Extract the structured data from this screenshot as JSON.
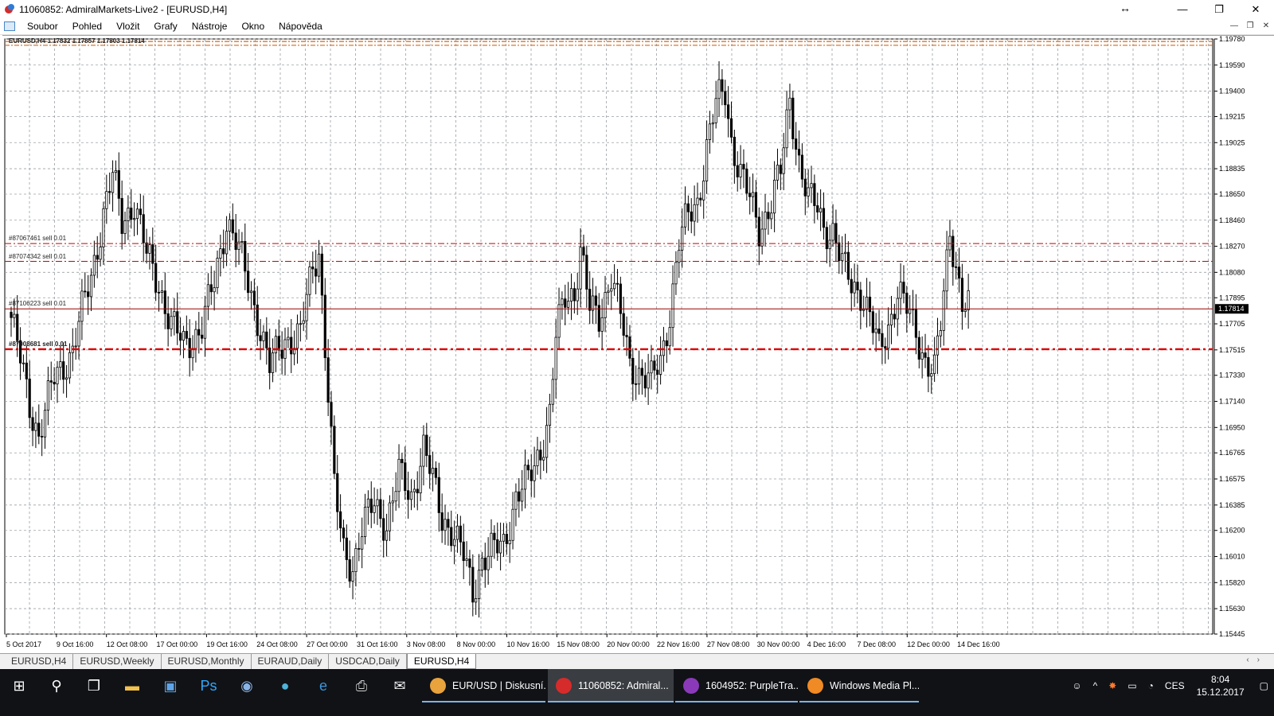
{
  "window": {
    "title": "11060852: AdmiralMarkets-Live2 - [EURUSD,H4]",
    "controls": [
      "↔",
      "—",
      "❐",
      "✕"
    ]
  },
  "menu": [
    "Soubor",
    "Pohled",
    "Vložit",
    "Grafy",
    "Nástroje",
    "Okno",
    "Nápověda"
  ],
  "chart": {
    "header": "EURUSD,H4  1.17832 1.17857 1.17803 1.17814",
    "current_price": "1.17814",
    "order_lines": [
      {
        "label": "#87067461 sell 0.01",
        "price": 1.1829,
        "color": "#cc0000",
        "style": "dashdot"
      },
      {
        "label": "#87074342 sell 0.01",
        "price": 1.1816,
        "color": "#cc0000",
        "style": "dashdot"
      },
      {
        "label": "#87106223 sell 0.01",
        "price": 1.17814,
        "color": "#990000",
        "style": "solid"
      },
      {
        "label": "#87008681 sell 0.01",
        "price": 1.1752,
        "color": "#dd0000",
        "style": "dashdot-bold"
      }
    ],
    "top_lines": [
      {
        "price": 1.19762,
        "color": "#d2691e"
      },
      {
        "price": 1.19734,
        "color": "#d2691e"
      }
    ],
    "y_axis": [
      "1.19780",
      "1.19590",
      "1.19400",
      "1.19215",
      "1.19025",
      "1.18835",
      "1.18650",
      "1.18460",
      "1.18270",
      "1.18080",
      "1.17895",
      "1.17705",
      "1.17515",
      "1.17330",
      "1.17140",
      "1.16950",
      "1.16765",
      "1.16575",
      "1.16385",
      "1.16200",
      "1.16010",
      "1.15820",
      "1.15630",
      "1.15445"
    ],
    "x_axis": [
      "5 Oct 2017",
      "9 Oct 16:00",
      "12 Oct 08:00",
      "17 Oct 00:00",
      "19 Oct 16:00",
      "24 Oct 08:00",
      "27 Oct 00:00",
      "31 Oct 16:00",
      "3 Nov 08:00",
      "8 Nov 00:00",
      "10 Nov 16:00",
      "15 Nov 08:00",
      "20 Nov 00:00",
      "22 Nov 16:00",
      "27 Nov 08:00",
      "30 Nov 00:00",
      "4 Dec 16:00",
      "7 Dec 08:00",
      "12 Dec 00:00",
      "14 Dec 16:00"
    ]
  },
  "chart_data": {
    "type": "candlestick",
    "symbol": "EURUSD",
    "timeframe": "H4",
    "ylim": [
      1.15445,
      1.1978
    ],
    "grid": true,
    "close_path": [
      [
        0,
        1.1775
      ],
      [
        6,
        1.1712
      ],
      [
        9,
        1.169
      ],
      [
        14,
        1.173
      ],
      [
        20,
        1.1752
      ],
      [
        26,
        1.1805
      ],
      [
        30,
        1.1852
      ],
      [
        33,
        1.1878
      ],
      [
        36,
        1.1845
      ],
      [
        40,
        1.186
      ],
      [
        44,
        1.182
      ],
      [
        48,
        1.18
      ],
      [
        52,
        1.177
      ],
      [
        56,
        1.1755
      ],
      [
        62,
        1.1768
      ],
      [
        66,
        1.18
      ],
      [
        70,
        1.1848
      ],
      [
        73,
        1.183
      ],
      [
        77,
        1.18
      ],
      [
        81,
        1.1768
      ],
      [
        84,
        1.1738
      ],
      [
        89,
        1.176
      ],
      [
        94,
        1.1762
      ],
      [
        98,
        1.1812
      ],
      [
        100,
        1.1825
      ],
      [
        102,
        1.1755
      ],
      [
        103,
        1.172
      ],
      [
        105,
        1.165
      ],
      [
        108,
        1.1605
      ],
      [
        111,
        1.1595
      ],
      [
        114,
        1.162
      ],
      [
        118,
        1.164
      ],
      [
        122,
        1.1625
      ],
      [
        126,
        1.166
      ],
      [
        130,
        1.1645
      ],
      [
        134,
        1.168
      ],
      [
        137,
        1.1655
      ],
      [
        140,
        1.163
      ],
      [
        143,
        1.1622
      ],
      [
        147,
        1.16
      ],
      [
        150,
        1.1575
      ],
      [
        153,
        1.16
      ],
      [
        157,
        1.1605
      ],
      [
        160,
        1.161
      ],
      [
        164,
        1.1645
      ],
      [
        168,
        1.1655
      ],
      [
        172,
        1.168
      ],
      [
        175,
        1.1705
      ],
      [
        177,
        1.176
      ],
      [
        180,
        1.179
      ],
      [
        183,
        1.1795
      ],
      [
        185,
        1.1825
      ],
      [
        188,
        1.178
      ],
      [
        191,
        1.1775
      ],
      [
        195,
        1.1808
      ],
      [
        198,
        1.1775
      ],
      [
        201,
        1.174
      ],
      [
        205,
        1.1735
      ],
      [
        208,
        1.1728
      ],
      [
        211,
        1.1742
      ],
      [
        214,
        1.178
      ],
      [
        217,
        1.183
      ],
      [
        220,
        1.1848
      ],
      [
        223,
        1.186
      ],
      [
        226,
        1.19
      ],
      [
        229,
        1.193
      ],
      [
        232,
        1.194
      ],
      [
        234,
        1.1905
      ],
      [
        237,
        1.188
      ],
      [
        240,
        1.186
      ],
      [
        243,
        1.184
      ],
      [
        247,
        1.186
      ],
      [
        250,
        1.188
      ],
      [
        253,
        1.1935
      ],
      [
        256,
        1.189
      ],
      [
        259,
        1.186
      ],
      [
        262,
        1.1855
      ],
      [
        264,
        1.1842
      ],
      [
        267,
        1.1838
      ],
      [
        270,
        1.1812
      ],
      [
        273,
        1.18
      ],
      [
        276,
        1.1795
      ],
      [
        279,
        1.1775
      ],
      [
        282,
        1.175
      ],
      [
        285,
        1.177
      ],
      [
        288,
        1.1795
      ],
      [
        291,
        1.178
      ],
      [
        294,
        1.1765
      ],
      [
        297,
        1.1745
      ],
      [
        300,
        1.1735
      ],
      [
        302,
        1.1768
      ],
      [
        305,
        1.184
      ],
      [
        307,
        1.1815
      ],
      [
        309,
        1.1785
      ],
      [
        311,
        1.1781
      ]
    ]
  },
  "tabs": [
    "EURUSD,H4",
    "EURUSD,Weekly",
    "EURUSD,Monthly",
    "EURAUD,Daily",
    "USDCAD,Daily",
    "EURUSD,H4"
  ],
  "active_tab": 5,
  "taskbar": {
    "apps": [
      {
        "label": "EUR/USD | Diskusní...",
        "color": "#e8a33d"
      },
      {
        "label": "11060852: Admiral...",
        "color": "#d62b2b"
      },
      {
        "label": "1604952: PurpleTra...",
        "color": "#8a3ab9"
      },
      {
        "label": "Windows Media Pl...",
        "color": "#f08a24"
      }
    ],
    "lang": "CES",
    "time": "8:04",
    "date": "15.12.2017"
  }
}
